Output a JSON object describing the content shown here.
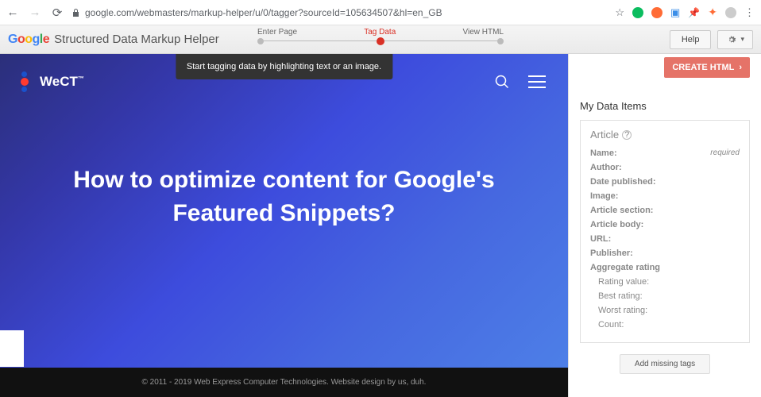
{
  "browser": {
    "url": "google.com/webmasters/markup-helper/u/0/tagger?sourceId=105634507&hl=en_GB"
  },
  "header": {
    "google": [
      "G",
      "o",
      "o",
      "g",
      "l",
      "e"
    ],
    "title": "Structured Data Markup Helper",
    "steps": [
      "Enter Page",
      "Tag Data",
      "View HTML"
    ],
    "active_step": 1,
    "help": "Help"
  },
  "tooltip": "Start tagging data by highlighting text or an image.",
  "site": {
    "logo": "WeCT",
    "tm": "™",
    "hero": "How to optimize content for Google's Featured Snippets?",
    "footer": "© 2011 - 2019 Web Express Computer Technologies. Website design by us, duh."
  },
  "sidebar": {
    "create": "CREATE HTML",
    "title": "My Data Items",
    "type": "Article",
    "fields": [
      {
        "label": "Name:",
        "extra": "required"
      },
      {
        "label": "Author:"
      },
      {
        "label": "Date published:"
      },
      {
        "label": "Image:"
      },
      {
        "label": "Article section:"
      },
      {
        "label": "Article body:"
      },
      {
        "label": "URL:"
      },
      {
        "label": "Publisher:"
      },
      {
        "label": "Aggregate rating"
      }
    ],
    "subfields": [
      "Rating value:",
      "Best rating:",
      "Worst rating:",
      "Count:"
    ],
    "add_tags": "Add missing tags"
  }
}
